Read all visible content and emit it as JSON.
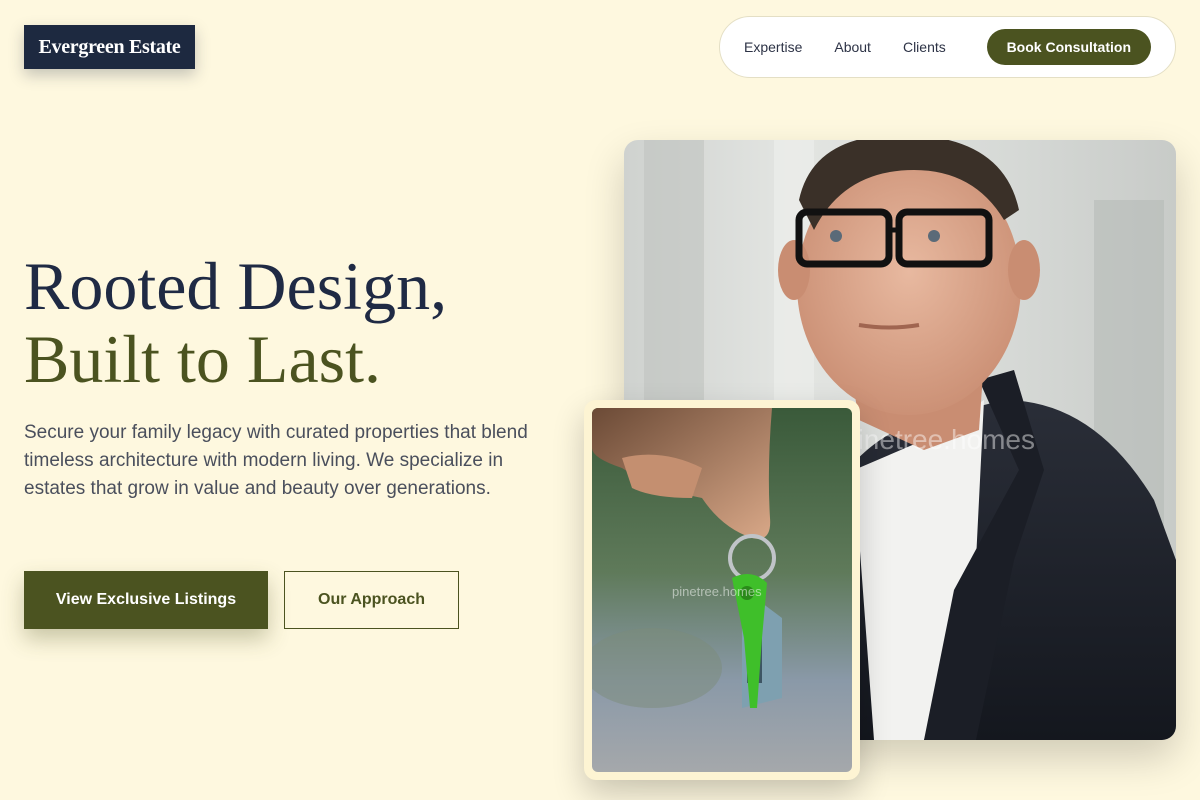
{
  "brand": {
    "name": "Evergreen Estate"
  },
  "nav": {
    "items": [
      "Expertise",
      "About",
      "Clients"
    ],
    "cta": "Book Consultation"
  },
  "hero": {
    "headline_line1": "Rooted Design,",
    "headline_line2": "Built to Last.",
    "description": "Secure your family legacy with curated properties that blend timeless architecture with modern living. We specialize in estates that grow in value and beauty over generations.",
    "primary_button": "View Exclusive Listings",
    "secondary_button": "Our Approach"
  },
  "images": {
    "main_alt": "portrait of a man with glasses in a dark suit",
    "main_watermark": "pinetree.homes",
    "keys_alt": "hand holding house-shaped keys",
    "keys_watermark": "pinetree.homes"
  },
  "colors": {
    "background": "#fef8df",
    "navy": "#1d2940",
    "olive": "#4b5320",
    "white": "#ffffff"
  }
}
